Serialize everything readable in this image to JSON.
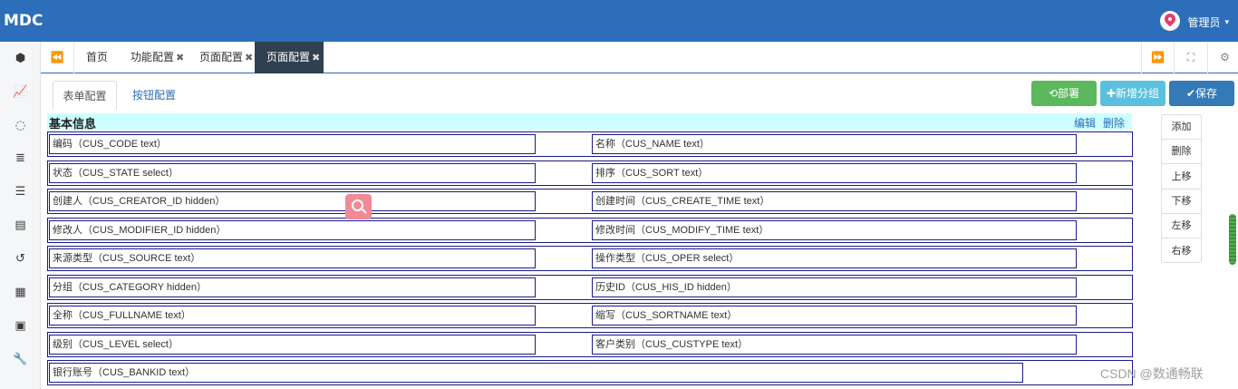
{
  "app": {
    "logo": "MDC"
  },
  "user": {
    "name": "管理员",
    "caret": "▾"
  },
  "sidebar": {
    "icons": [
      {
        "name": "cube-icon",
        "glyph": "⬢"
      },
      {
        "name": "line-chart-icon",
        "glyph": "📈"
      },
      {
        "name": "spinner-icon",
        "glyph": "◌"
      },
      {
        "name": "database-icon",
        "glyph": "≣"
      },
      {
        "name": "list-icon",
        "glyph": "☰"
      },
      {
        "name": "id-card-icon",
        "glyph": "▤"
      },
      {
        "name": "history-icon",
        "glyph": "↺"
      },
      {
        "name": "film-icon",
        "glyph": "▦"
      },
      {
        "name": "archive-icon",
        "glyph": "▣"
      },
      {
        "name": "wrench-icon",
        "glyph": "🔧"
      }
    ]
  },
  "tabs": {
    "back_glyph": "⏪",
    "forward_glyph": "⏩",
    "fullscreen_glyph": "⛶",
    "settings_glyph": "⚙",
    "close_glyph": "✖",
    "items": [
      {
        "label": "首页",
        "closable": false,
        "active": false
      },
      {
        "label": "功能配置",
        "closable": true,
        "active": false
      },
      {
        "label": "页面配置",
        "closable": true,
        "active": false
      },
      {
        "label": "页面配置",
        "closable": true,
        "active": true
      }
    ]
  },
  "subtabs": {
    "form": "表单配置",
    "buttons": "按钮配置"
  },
  "actions": {
    "deploy": "⟲部署",
    "add_group": "✚新增分组",
    "save": "✔保存"
  },
  "form": {
    "section_title": "基本信息",
    "edit_link": "编辑",
    "delete_link": "删除",
    "rows": [
      [
        "编码（CUS_CODE  text）",
        "名称（CUS_NAME  text）"
      ],
      [
        "状态（CUS_STATE  select）",
        "排序（CUS_SORT  text）"
      ],
      [
        "创建人（CUS_CREATOR_ID  hidden）",
        "创建时间（CUS_CREATE_TIME  text）"
      ],
      [
        "修改人（CUS_MODIFIER_ID  hidden）",
        "修改时间（CUS_MODIFY_TIME  text）"
      ],
      [
        "来源类型（CUS_SOURCE  text）",
        "操作类型（CUS_OPER  select）"
      ],
      [
        "分组（CUS_CATEGORY  hidden）",
        "历史ID（CUS_HIS_ID  hidden）"
      ],
      [
        "全称（CUS_FULLNAME  text）",
        "缩写（CUS_SORTNAME  text）"
      ],
      [
        "级别（CUS_LEVEL  select）",
        "客户类别（CUS_CUSTYPE  text）"
      ],
      [
        "银行账号（CUS_BANKID  text）"
      ]
    ]
  },
  "field_ops": [
    "添加",
    "删除",
    "上移",
    "下移",
    "左移",
    "右移"
  ],
  "watermark": "CSDN @数通畅联",
  "colors": {
    "header": "#2c6eba",
    "active_tab": "#2f4050",
    "section_bg": "#ccffff",
    "field_border": "#1a1a8c",
    "deploy": "#5cb85c",
    "add_group": "#5bc0de",
    "save": "#337ab7"
  }
}
